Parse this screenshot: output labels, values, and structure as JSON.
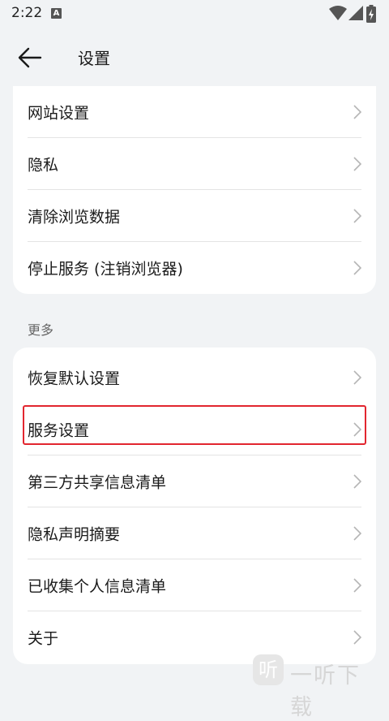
{
  "status_bar": {
    "time": "2:22",
    "notification_letter": "A"
  },
  "header": {
    "title": "设置"
  },
  "top_group": {
    "items": [
      {
        "label": "网站设置"
      },
      {
        "label": "隐私"
      },
      {
        "label": "清除浏览数据"
      },
      {
        "label": "停止服务 (注销浏览器)"
      }
    ]
  },
  "more_section": {
    "label": "更多",
    "items": [
      {
        "label": "恢复默认设置"
      },
      {
        "label": "服务设置"
      },
      {
        "label": "第三方共享信息清单"
      },
      {
        "label": "隐私声明摘要"
      },
      {
        "label": "已收集个人信息清单"
      },
      {
        "label": "关于"
      }
    ]
  },
  "watermark": {
    "icon_text": "听",
    "text": "一听下载"
  },
  "colors": {
    "highlight": "#e2262f",
    "background": "#f1f3f5",
    "card": "#ffffff"
  }
}
